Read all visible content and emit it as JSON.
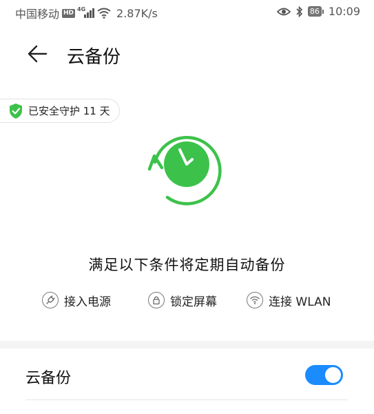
{
  "status_bar": {
    "carrier": "中国移动",
    "hd_badge": "HD",
    "network": "4G",
    "speed": "2.87K/s",
    "battery": "86",
    "time": "10:09"
  },
  "header": {
    "title": "云备份"
  },
  "protection": {
    "text": "已安全守护 11 天"
  },
  "conditions": {
    "title": "满足以下条件将定期自动备份",
    "items": [
      {
        "label": "接入电源",
        "icon": "plug-icon"
      },
      {
        "label": "锁定屏幕",
        "icon": "lock-icon"
      },
      {
        "label": "连接 WLAN",
        "icon": "wifi-icon"
      }
    ]
  },
  "settings": {
    "cloud_backup_label": "云备份",
    "cloud_backup_enabled": true
  },
  "colors": {
    "accent_green": "#3cc24a",
    "toggle_blue": "#1a8cff"
  }
}
